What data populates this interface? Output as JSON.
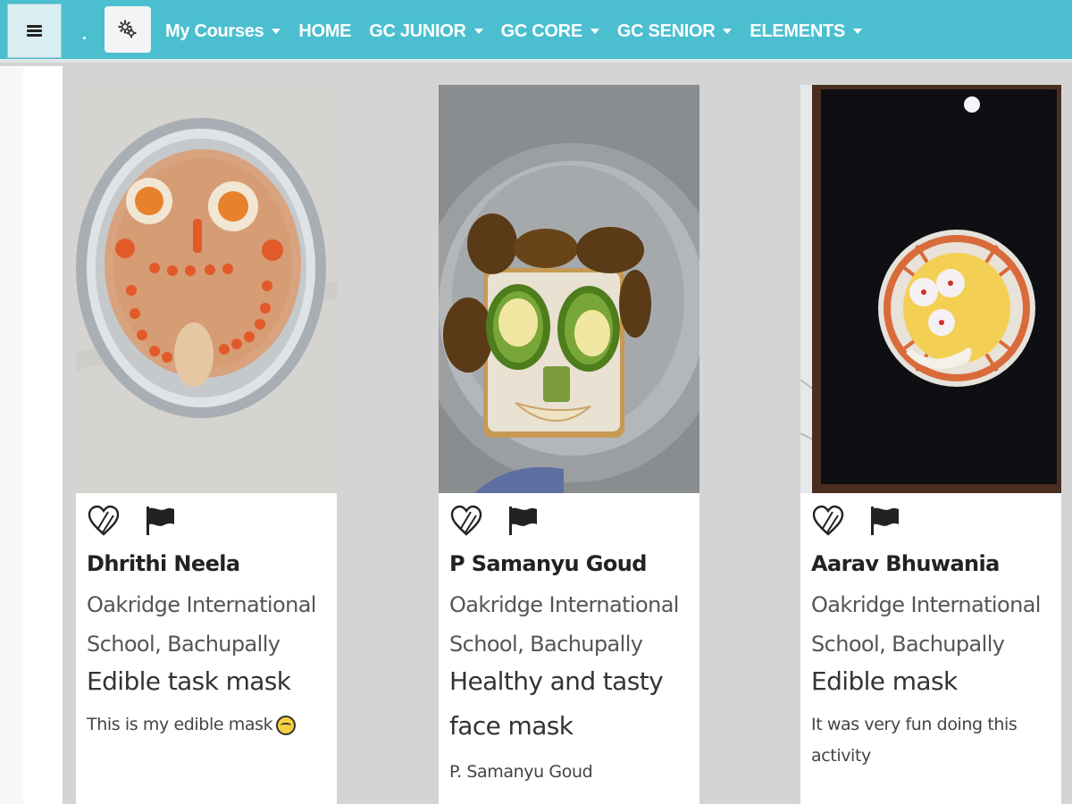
{
  "nav": {
    "dot": ".",
    "items": [
      {
        "label": "My Courses",
        "dropdown": true
      },
      {
        "label": "HOME",
        "dropdown": false
      },
      {
        "label": "GC JUNIOR",
        "dropdown": true
      },
      {
        "label": "GC CORE",
        "dropdown": true
      },
      {
        "label": "GC SENIOR",
        "dropdown": true
      },
      {
        "label": "ELEMENTS",
        "dropdown": true
      }
    ]
  },
  "colors": {
    "navbar": "#4bbfcf",
    "content_bg": "#d4d4d4"
  },
  "icons": {
    "menu": "hamburger-menu-icon",
    "settings": "gears-icon",
    "like": "heart-icon",
    "report": "flag-icon"
  },
  "cards": [
    {
      "name": "Dhrithi Neela",
      "school": "Oakridge International School, Bachupally",
      "title": "Edible task mask",
      "description": "This is my edible mask",
      "description_emoji": true
    },
    {
      "name": "P Samanyu Goud",
      "school": "Oakridge International School, Bachupally",
      "title": "Healthy and tasty face mask",
      "description": "P. Samanyu Goud",
      "description_emoji": false
    },
    {
      "name": "Aarav Bhuwania",
      "school": "Oakridge International School, Bachupally",
      "title": "Edible mask",
      "description": "It was very fun doing this activity",
      "description_emoji": false
    }
  ]
}
